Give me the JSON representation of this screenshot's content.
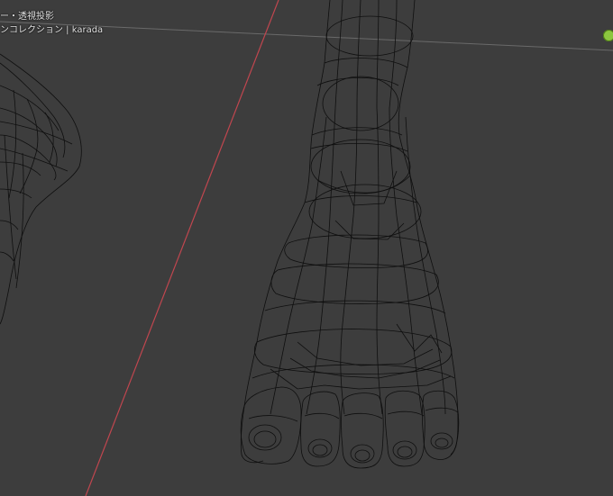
{
  "viewport": {
    "projection_label": "ー・透視投影",
    "collection_label": "ンコレクション | karada"
  },
  "colors": {
    "background": "#3d3d3d",
    "x_axis": "#c0464f",
    "wire": "#0f0f0f",
    "gizmo": "#8cc63f"
  },
  "icons": {
    "gizmo": "green-axis-dot-icon"
  }
}
